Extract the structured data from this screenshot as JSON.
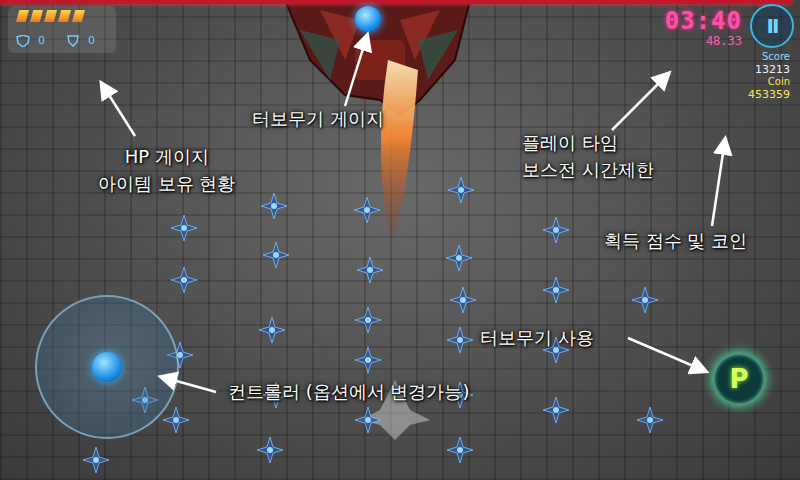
{
  "hud": {
    "hp": [
      {
        "filled": true
      },
      {
        "filled": true
      },
      {
        "filled": true
      },
      {
        "filled": true
      },
      {
        "filled": true
      }
    ],
    "items": [
      {
        "count": "0"
      },
      {
        "count": "0"
      }
    ],
    "timer": "03:40",
    "timer_sub": "48.33",
    "score_label": "Score",
    "score": "13213",
    "coin_label": "Coin",
    "coin": "453359",
    "pause": "II",
    "turbo_button": "P",
    "boss_hp": {
      "level": 0.99
    }
  },
  "annotations": [
    {
      "id": "hp",
      "lines": [
        "HP 게이지",
        "아이템 보유 현황"
      ]
    },
    {
      "id": "turbo-gauge",
      "lines": [
        "터보무기 게이지"
      ]
    },
    {
      "id": "time",
      "lines": [
        "플레이 타임",
        "보스전 시간제한"
      ]
    },
    {
      "id": "score",
      "lines": [
        "획득 점수 및 코인"
      ]
    },
    {
      "id": "turbo-use",
      "lines": [
        "터보무기 사용"
      ]
    },
    {
      "id": "controller",
      "lines": [
        "컨트롤러 (옵션에서 변경가능)"
      ]
    }
  ]
}
